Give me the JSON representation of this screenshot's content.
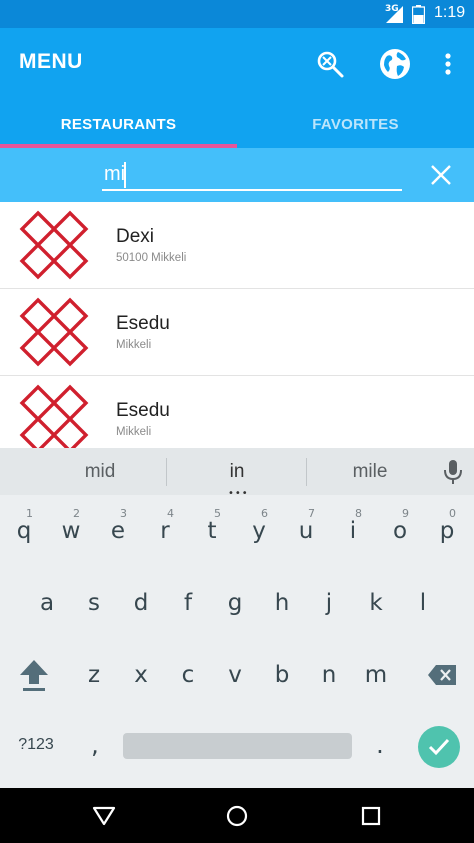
{
  "status_bar": {
    "network": "3G",
    "battery_level": "2",
    "time": "1:19"
  },
  "app_bar": {
    "title": "MENU",
    "icons": [
      "search-off-icon",
      "globe-icon",
      "more-vert-icon"
    ]
  },
  "tabs": [
    {
      "label": "RESTAURANTS",
      "active": true
    },
    {
      "label": "FAVORITES",
      "active": false
    }
  ],
  "search": {
    "value": "mi",
    "placeholder": ""
  },
  "restaurants": [
    {
      "name": "Dexi",
      "location": "50100 Mikkeli"
    },
    {
      "name": "Esedu",
      "location": "Mikkeli"
    },
    {
      "name": "Esedu",
      "location": "Mikkeli"
    }
  ],
  "keyboard": {
    "suggestions": [
      "mid",
      "in",
      "mile"
    ],
    "row1": [
      {
        "key": "q",
        "hint": "1"
      },
      {
        "key": "w",
        "hint": "2"
      },
      {
        "key": "e",
        "hint": "3"
      },
      {
        "key": "r",
        "hint": "4"
      },
      {
        "key": "t",
        "hint": "5"
      },
      {
        "key": "y",
        "hint": "6"
      },
      {
        "key": "u",
        "hint": "7"
      },
      {
        "key": "i",
        "hint": "8"
      },
      {
        "key": "o",
        "hint": "9"
      },
      {
        "key": "p",
        "hint": "0"
      }
    ],
    "row2": [
      "a",
      "s",
      "d",
      "f",
      "g",
      "h",
      "j",
      "k",
      "l"
    ],
    "row3": [
      "z",
      "x",
      "c",
      "v",
      "b",
      "n",
      "m"
    ],
    "symbols_label": "?123",
    "comma": ",",
    "period": "."
  },
  "colors": {
    "status_bar": "#0b88d8",
    "app_bar": "#11a3f0",
    "search_bar": "#44bffa",
    "tab_indicator": "#e8549a",
    "logo_red": "#d0202e",
    "enter_key": "#4fc3ae"
  }
}
